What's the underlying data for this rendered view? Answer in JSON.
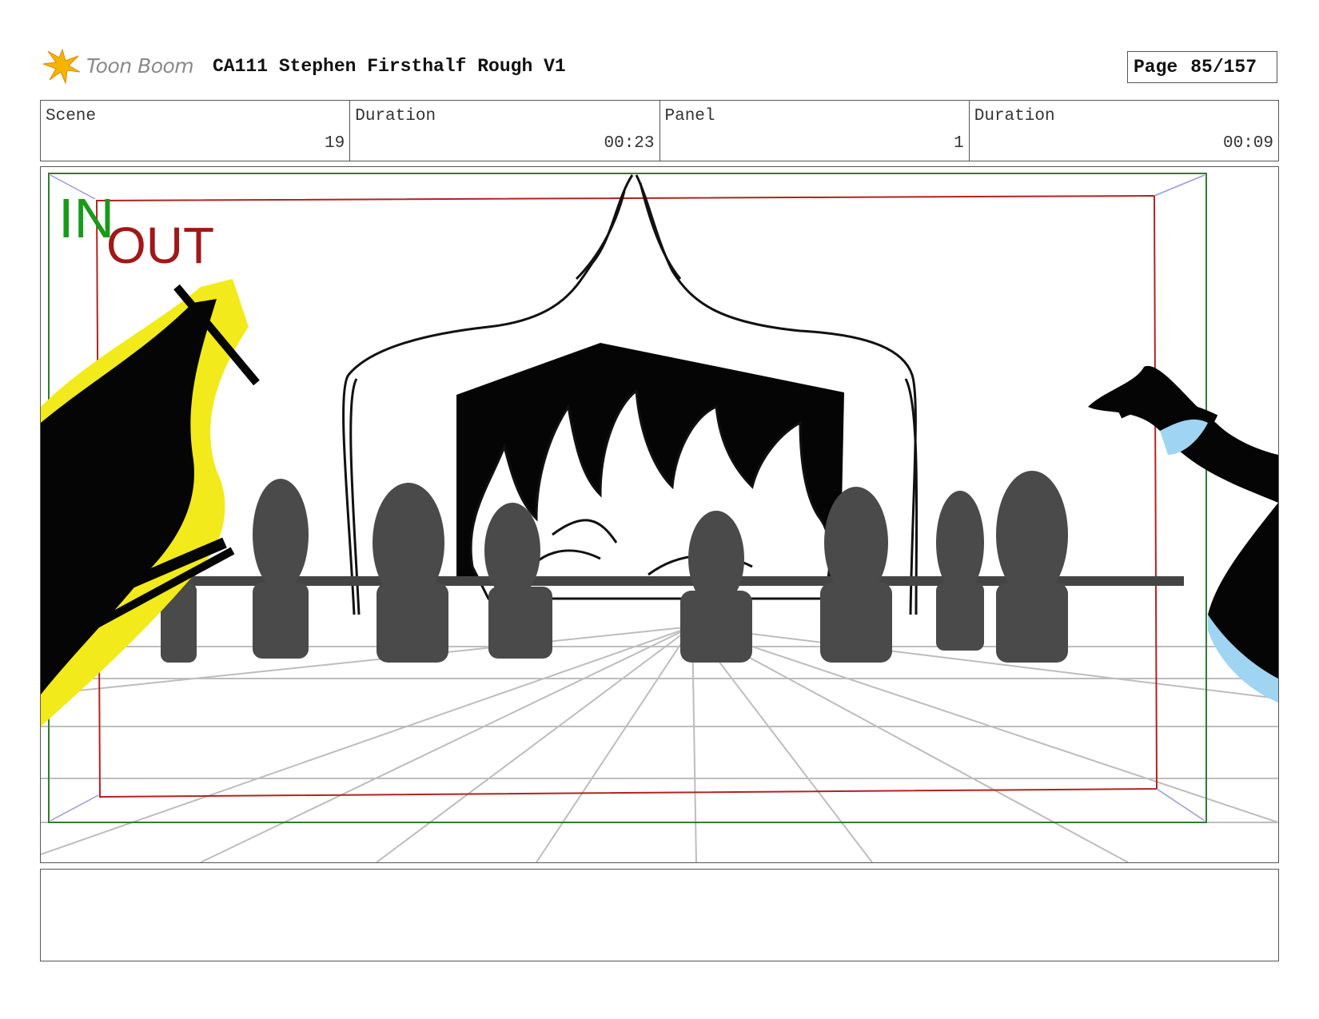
{
  "header": {
    "brand": "Toon Boom",
    "title": "CA111 Stephen Firsthalf Rough V1",
    "page_label": "Page",
    "page_number": "85/157"
  },
  "info": {
    "scene_label": "Scene",
    "scene_value": "19",
    "scene_duration_label": "Duration",
    "scene_duration_value": "00:23",
    "panel_label": "Panel",
    "panel_value": "1",
    "panel_duration_label": "Duration",
    "panel_duration_value": "00:09"
  },
  "frame": {
    "in_label": "IN",
    "out_label": "OUT",
    "in_color": "#1a9a1a",
    "out_color": "#a01818"
  },
  "caption": {
    "text": ""
  }
}
